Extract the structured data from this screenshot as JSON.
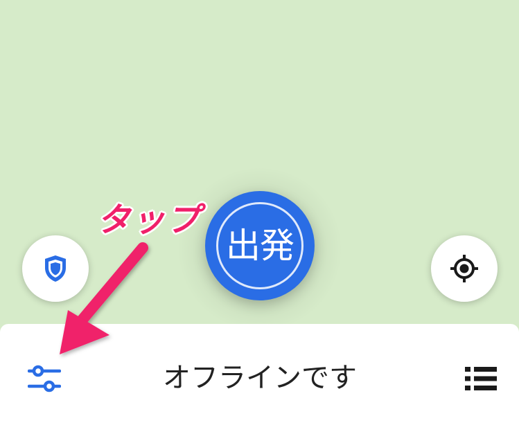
{
  "map": {
    "background": "#d6ebc9"
  },
  "go_button": {
    "label": "出発",
    "color": "#2a6de5"
  },
  "annotation": {
    "text": "タップ",
    "color": "#f0206a"
  },
  "bottom_sheet": {
    "title": "オフラインです"
  },
  "icons": {
    "shield": "shield-icon",
    "locate": "my-location-icon",
    "filter": "sliders-icon",
    "list": "list-icon"
  },
  "colors": {
    "accent": "#2a6de5",
    "icon_dark": "#1a1a1a"
  }
}
